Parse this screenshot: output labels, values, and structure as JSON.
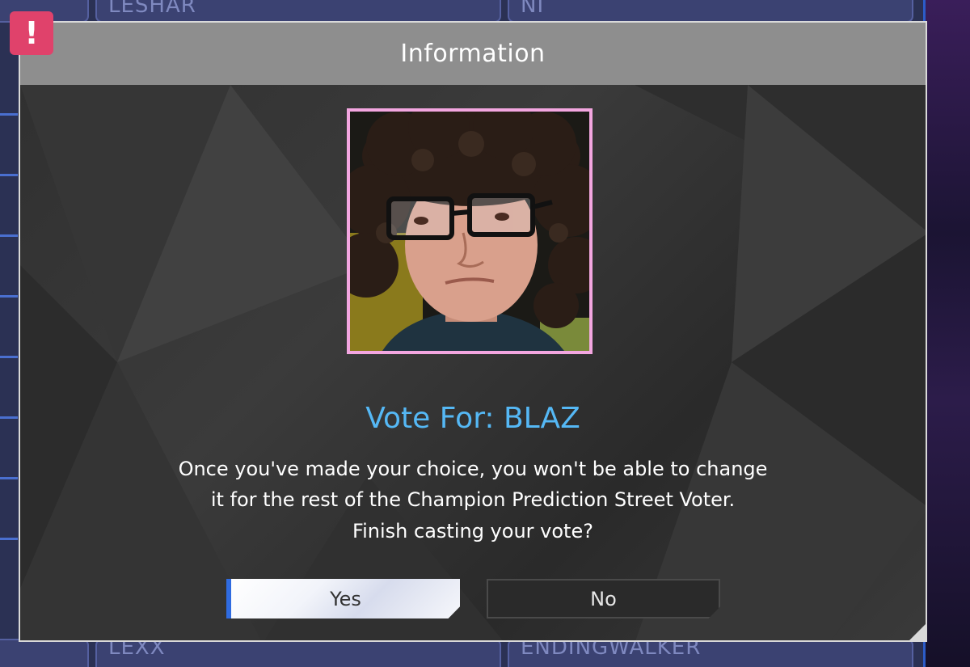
{
  "background": {
    "tile_names": [
      "LESHAR",
      "NI",
      "LEXX",
      "ENDINGWALKER"
    ]
  },
  "dialog": {
    "title": "Information",
    "alert_badge": "!",
    "vote_title": "Vote For: BLAZ",
    "message_lines": [
      "Once you've made your choice, you won't be able to change",
      "it for the rest of the Champion Prediction Street Voter.",
      "Finish casting your vote?"
    ],
    "buttons": {
      "yes": "Yes",
      "no": "No"
    },
    "colors": {
      "vote_title": "#55b8f5",
      "portrait_border": "#f3a6e0",
      "alert_badge": "#e0426b",
      "yes_accent": "#2f6be0"
    },
    "portrait_icon": "player-portrait-photo"
  }
}
